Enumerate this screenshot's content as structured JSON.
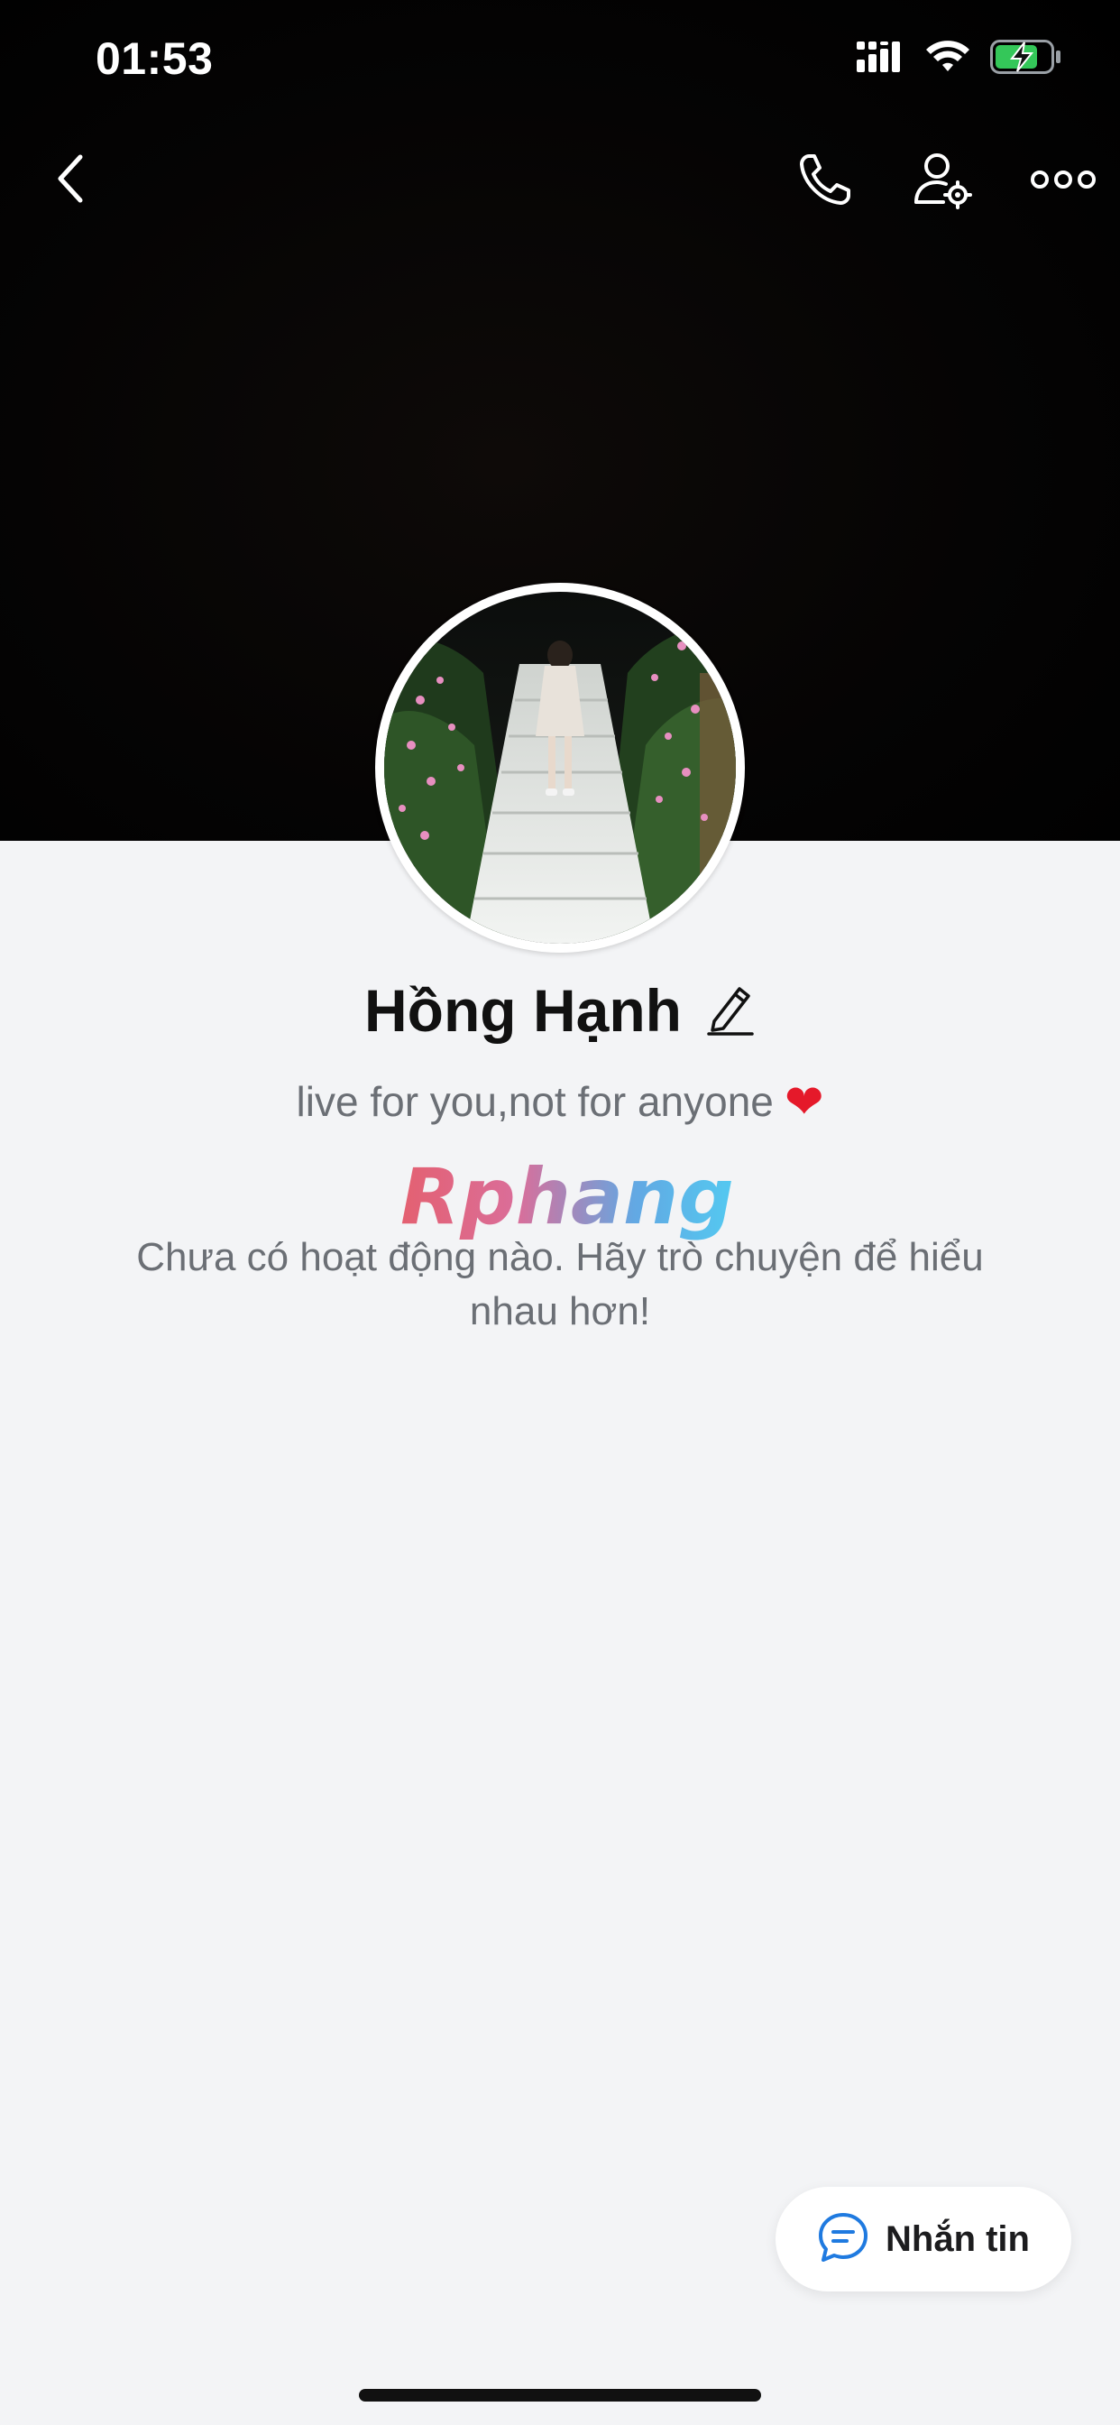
{
  "status_bar": {
    "time": "01:53"
  },
  "profile": {
    "name": "Hồng Hạnh",
    "bio": "live for you,not for anyone",
    "bio_emoji": "❤",
    "empty_activity_message": "Chưa có hoạt động nào. Hãy trò chuyện để hiểu nhau hơn!"
  },
  "watermark": {
    "text": "Rphang"
  },
  "actions": {
    "message_label": "Nhắn tin"
  },
  "icons": {
    "back": "chevron-left-icon",
    "call": "phone-icon",
    "profile_settings": "user-settings-icon",
    "more": "more-horizontal-icon",
    "edit": "pencil-icon",
    "message": "chat-bubble-icon",
    "signal": "cellular-signal-icon",
    "wifi": "wifi-icon",
    "battery": "battery-charging-icon"
  },
  "colors": {
    "accent": "#1f7ae0",
    "battery": "#34c759",
    "background": "#f3f4f6",
    "heart": "#e5192a"
  }
}
